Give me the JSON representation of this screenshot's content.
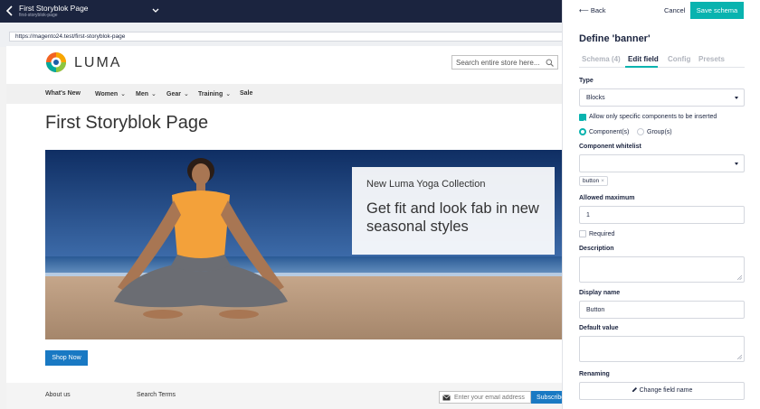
{
  "topbar": {
    "title": "First Storyblok Page",
    "subtitle": "first-storyblok-page"
  },
  "preview": {
    "url": "https://magento24.test/first-storyblok-page",
    "logo_text": "LUMA",
    "search_placeholder": "Search entire store here...",
    "nav": [
      {
        "label": "What's New",
        "chevron": ""
      },
      {
        "label": "Women",
        "chevron": "⌄"
      },
      {
        "label": "Men",
        "chevron": "⌄"
      },
      {
        "label": "Gear",
        "chevron": "⌄"
      },
      {
        "label": "Training",
        "chevron": "⌄"
      },
      {
        "label": "Sale",
        "chevron": ""
      }
    ],
    "page_title": "First Storyblok Page",
    "banner": {
      "kicker": "New Luma Yoga Collection",
      "headline": "Get fit and look fab in new seasonal styles"
    },
    "shop_button": "Shop Now",
    "footer": {
      "links": [
        "About us",
        "Search Terms"
      ],
      "email_placeholder": "Enter your email address",
      "subscribe": "Subscribe"
    }
  },
  "panel": {
    "back": "Back",
    "cancel": "Cancel",
    "save": "Save schema",
    "heading": "Define 'banner'",
    "tabs": [
      {
        "label": "Schema (4)",
        "active": false
      },
      {
        "label": "Edit field",
        "active": true
      },
      {
        "label": "Config",
        "active": false
      },
      {
        "label": "Presets",
        "active": false
      }
    ],
    "type_label": "Type",
    "type_value": "Blocks",
    "allow_specific": "Allow only specific components to be inserted",
    "allow_specific_checked": true,
    "radio_components": "Component(s)",
    "radio_groups": "Group(s)",
    "whitelist_label": "Component whitelist",
    "whitelist_chip": "button",
    "whitelist_chip_remove": "×",
    "allowed_max_label": "Allowed maximum",
    "allowed_max_value": "1",
    "required_label": "Required",
    "required_checked": false,
    "description_label": "Description",
    "display_name_label": "Display name",
    "display_name_placeholder": "Button",
    "default_value_label": "Default value",
    "renaming_label": "Renaming",
    "change_field_name": "Change field name"
  },
  "colors": {
    "topbar": "#1b243f",
    "accent_teal": "#09b3af",
    "luma_blue": "#1979c3"
  }
}
